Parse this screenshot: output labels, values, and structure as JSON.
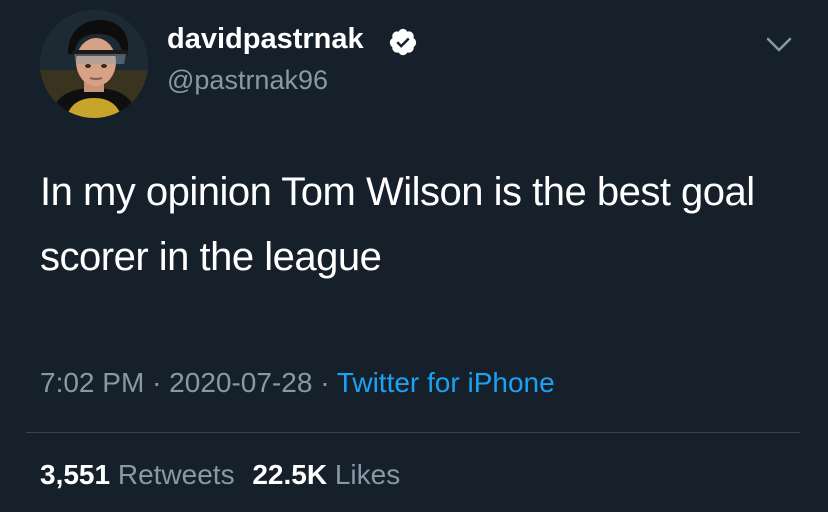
{
  "user": {
    "display_name": "davidpastrnak",
    "handle": "@pastrnak96",
    "verified_icon": "verified-badge-icon"
  },
  "menu_icon": "chevron-down-icon",
  "tweet": {
    "text": "In my opinion Tom Wilson is the best goal scorer in the league",
    "time": "7:02 PM",
    "separator": "·",
    "date": "2020-07-28",
    "source": "Twitter for iPhone"
  },
  "stats": {
    "retweets_count": "3,551",
    "retweets_label": "Retweets",
    "likes_count": "22.5K",
    "likes_label": "Likes"
  },
  "colors": {
    "background": "#15202b",
    "text": "#ffffff",
    "secondary": "#8899a6",
    "link": "#1da1f2",
    "divider": "#38444d"
  }
}
